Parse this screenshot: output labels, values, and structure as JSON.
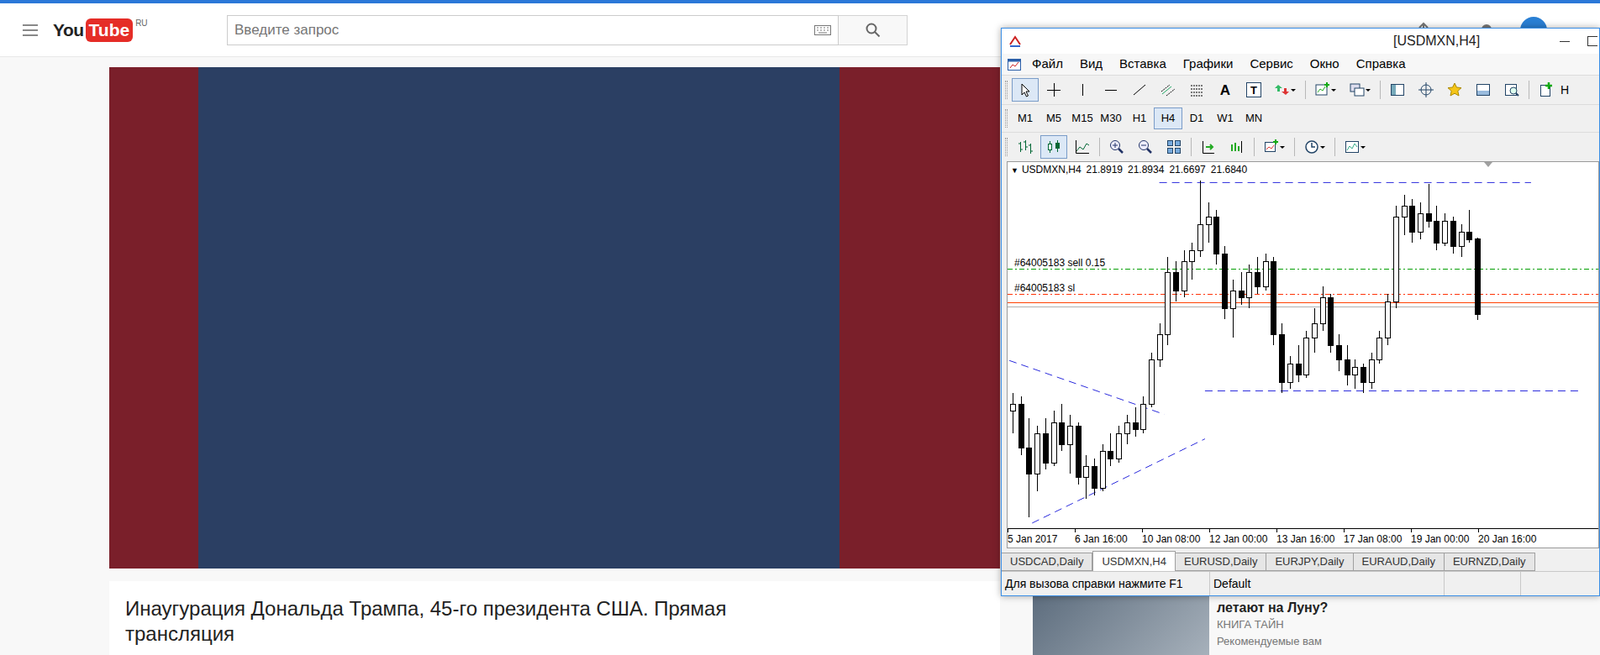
{
  "youtube": {
    "logo": {
      "you": "You",
      "tube": "Tube",
      "region": "RU"
    },
    "search": {
      "placeholder": "Введите запрос"
    },
    "video": {
      "title": "Инаугурация Дональда Трампа, 45-го президента США. Прямая трансляция"
    },
    "recommended": [
      {
        "title": "летают на Луну?",
        "channel": "КНИГА ТАЙН",
        "note": "Рекомендуемые вам"
      }
    ]
  },
  "terminal": {
    "window": {
      "title": "[USDMXN,H4]"
    },
    "menu": [
      "Файл",
      "Вид",
      "Вставка",
      "Графики",
      "Сервис",
      "Окно",
      "Справка"
    ],
    "toolbar": {
      "drawing_tools": [
        {
          "selected": true
        },
        {
          "selected": false
        },
        {
          "selected": false
        },
        {
          "selected": false
        },
        {
          "selected": false
        },
        {
          "selected": false
        },
        {
          "selected": false
        },
        {
          "selected": false,
          "glyph": "A"
        },
        {
          "selected": false,
          "glyph": "T"
        },
        {
          "selected": false
        }
      ],
      "cut_label": "H"
    },
    "timeframes": [
      {
        "label": "M1",
        "selected": false
      },
      {
        "label": "M5",
        "selected": false
      },
      {
        "label": "M15",
        "selected": false
      },
      {
        "label": "M30",
        "selected": false
      },
      {
        "label": "H1",
        "selected": false
      },
      {
        "label": "H4",
        "selected": true
      },
      {
        "label": "D1",
        "selected": false
      },
      {
        "label": "W1",
        "selected": false
      },
      {
        "label": "MN",
        "selected": false
      }
    ],
    "chart_toolbar": [
      {
        "selected": false
      },
      {
        "selected": true
      },
      {
        "selected": false
      },
      {
        "selected": false
      },
      {
        "selected": false
      },
      {
        "selected": false
      },
      {
        "selected": false
      },
      {
        "selected": false
      },
      {
        "selected": false
      },
      {
        "selected": false
      },
      {
        "selected": false
      }
    ],
    "chart": {
      "header": {
        "marker": "▼",
        "symbol": "USDMXN,H4",
        "prices": [
          "21.8919",
          "21.8934",
          "21.6697",
          "21.6840"
        ]
      },
      "candles": [
        [
          21.42,
          21.47,
          21.36,
          21.44
        ],
        [
          21.44,
          21.46,
          21.3,
          21.32
        ],
        [
          21.32,
          21.4,
          21.13,
          21.25
        ],
        [
          21.25,
          21.38,
          21.2,
          21.36
        ],
        [
          21.36,
          21.4,
          21.26,
          21.28
        ],
        [
          21.28,
          21.42,
          21.27,
          21.39
        ],
        [
          21.39,
          21.44,
          21.31,
          21.33
        ],
        [
          21.33,
          21.41,
          21.25,
          21.38
        ],
        [
          21.38,
          21.39,
          21.22,
          21.24
        ],
        [
          21.24,
          21.3,
          21.18,
          21.27
        ],
        [
          21.27,
          21.29,
          21.19,
          21.21
        ],
        [
          21.21,
          21.33,
          21.2,
          21.31
        ],
        [
          21.31,
          21.36,
          21.27,
          21.29
        ],
        [
          21.29,
          21.38,
          21.28,
          21.36
        ],
        [
          21.36,
          21.41,
          21.33,
          21.39
        ],
        [
          21.39,
          21.43,
          21.35,
          21.37
        ],
        [
          21.37,
          21.46,
          21.36,
          21.44
        ],
        [
          21.44,
          21.58,
          21.43,
          21.56
        ],
        [
          21.56,
          21.66,
          21.54,
          21.63
        ],
        [
          21.63,
          21.84,
          21.6,
          21.8
        ],
        [
          21.8,
          21.83,
          21.72,
          21.75
        ],
        [
          21.75,
          21.86,
          21.73,
          21.83
        ],
        [
          21.83,
          21.88,
          21.78,
          21.86
        ],
        [
          21.86,
          22.05,
          21.84,
          21.93
        ],
        [
          21.93,
          21.99,
          21.88,
          21.95
        ],
        [
          21.95,
          21.97,
          21.82,
          21.85
        ],
        [
          21.85,
          21.87,
          21.67,
          21.7
        ],
        [
          21.7,
          21.78,
          21.62,
          21.75
        ],
        [
          21.75,
          21.8,
          21.71,
          21.73
        ],
        [
          21.73,
          21.82,
          21.7,
          21.8
        ],
        [
          21.8,
          21.84,
          21.74,
          21.76
        ],
        [
          21.76,
          21.85,
          21.75,
          21.83
        ],
        [
          21.83,
          21.84,
          21.6,
          21.63
        ],
        [
          21.63,
          21.66,
          21.47,
          21.5
        ],
        [
          21.5,
          21.57,
          21.48,
          21.55
        ],
        [
          21.55,
          21.6,
          21.5,
          21.52
        ],
        [
          21.52,
          21.64,
          21.51,
          21.62
        ],
        [
          21.62,
          21.7,
          21.58,
          21.66
        ],
        [
          21.66,
          21.76,
          21.64,
          21.73
        ],
        [
          21.73,
          21.74,
          21.58,
          21.6
        ],
        [
          21.6,
          21.63,
          21.53,
          21.56
        ],
        [
          21.56,
          21.6,
          21.49,
          21.52
        ],
        [
          21.52,
          21.56,
          21.48,
          21.54
        ],
        [
          21.54,
          21.55,
          21.47,
          21.5
        ],
        [
          21.5,
          21.58,
          21.48,
          21.56
        ],
        [
          21.56,
          21.64,
          21.55,
          21.62
        ],
        [
          21.62,
          21.74,
          21.6,
          21.72
        ],
        [
          21.72,
          21.98,
          21.7,
          21.95
        ],
        [
          21.95,
          22.01,
          21.9,
          21.98
        ],
        [
          21.98,
          22.0,
          21.88,
          21.91
        ],
        [
          21.91,
          21.99,
          21.89,
          21.96
        ],
        [
          21.96,
          22.04,
          21.92,
          21.94
        ],
        [
          21.94,
          21.98,
          21.86,
          21.88
        ],
        [
          21.88,
          21.96,
          21.87,
          21.94
        ],
        [
          21.94,
          21.95,
          21.85,
          21.87
        ],
        [
          21.87,
          21.93,
          21.84,
          21.91
        ],
        [
          21.91,
          21.97,
          21.88,
          21.89
        ],
        [
          21.8919,
          21.8934,
          21.6697,
          21.684
        ]
      ],
      "order_lines": [
        {
          "label": "#64005183 sell 0.15",
          "price": 21.808,
          "color": "#00a000",
          "kind": "dashdot"
        },
        {
          "label": "#64005183 sl",
          "price": 21.74,
          "color": "#ff3300",
          "kind": "dashdot"
        },
        {
          "price": 21.717,
          "color": "#ff4000",
          "kind": "solid"
        },
        {
          "price": 21.706,
          "color": "#b0b0b0",
          "kind": "solid"
        }
      ],
      "trendlines": [
        {
          "from": {
            "bar": -0.4,
            "price": 21.558
          },
          "to": {
            "bar": 18.6,
            "price": 21.411
          }
        },
        {
          "from": {
            "bar": 2.4,
            "price": 21.114
          },
          "to": {
            "bar": 23.6,
            "price": 21.344
          }
        },
        {
          "from": {
            "bar": 18,
            "price": 22.044
          },
          "to": {
            "bar": 63.6,
            "price": 22.044
          }
        },
        {
          "from": {
            "bar": 23.6,
            "price": 21.475
          },
          "to": {
            "bar": 69.6,
            "price": 21.475
          }
        }
      ],
      "time_axis": [
        "5 Jan 2017",
        "6 Jan 16:00",
        "10 Jan 08:00",
        "12 Jan 00:00",
        "13 Jan 16:00",
        "17 Jan 08:00",
        "19 Jan 00:00",
        "20 Jan 16:00"
      ]
    },
    "tabs": [
      {
        "label": "USDCAD,Daily",
        "selected": false
      },
      {
        "label": "USDMXN,H4",
        "selected": true
      },
      {
        "label": "EURUSD,Daily",
        "selected": false
      },
      {
        "label": "EURJPY,Daily",
        "selected": false
      },
      {
        "label": "EURAUD,Daily",
        "selected": false
      },
      {
        "label": "EURNZD,Daily",
        "selected": false
      }
    ],
    "status_bar": {
      "help": "Для вызова справки нажмите F1",
      "profile": "Default"
    }
  }
}
